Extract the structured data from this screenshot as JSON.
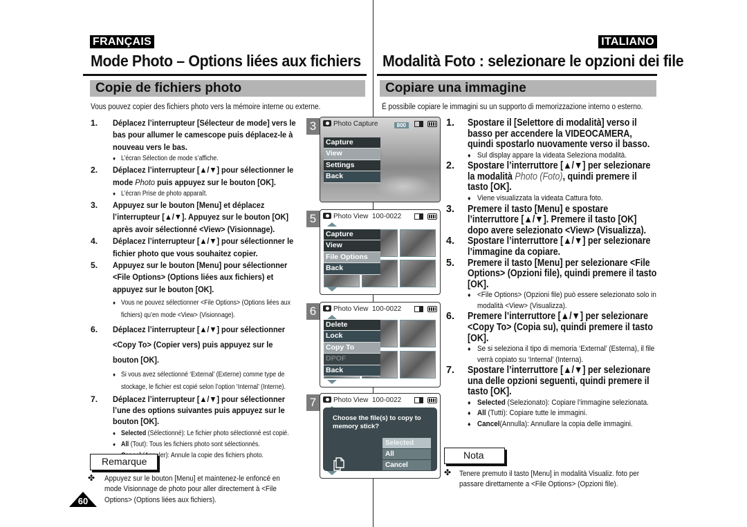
{
  "fr": {
    "lang": "FRANÇAIS",
    "title": "Mode Photo – Options liées aux fichiers",
    "section": "Copie de fichiers photo",
    "intro": "Vous pouvez copier des fichiers photo vers la mémoire interne ou externe.",
    "steps": [
      {
        "num": "1.",
        "text": "Déplacez l’interrupteur [Sélecteur de mode] vers le bas pour allumer le camescope puis déplacez-le à nouveau vers le bas.",
        "subs": [
          "L’écran Sélection de mode s’affiche."
        ]
      },
      {
        "num": "2.",
        "text_a": "Déplacez l’interrupteur [▲/▼] pour sélectionner le mode ",
        "text_em": "Photo",
        "text_b": " puis appuyez sur le bouton [OK].",
        "subs": [
          "L’écran Prise de photo apparaît."
        ]
      },
      {
        "num": "3.",
        "text": "Appuyez sur le bouton [Menu] et déplacez l’interrupteur [▲/▼]. Appuyez sur le bouton [OK] après avoir sélectionné <View> (Visionnage)."
      },
      {
        "num": "4.",
        "text": "Déplacez l’interrupteur [▲/▼] pour sélectionner le fichier photo que vous souhaitez copier."
      },
      {
        "num": "5.",
        "text": "Appuyez sur le bouton [Menu] pour sélectionner <File Options> (Options liées aux fichiers) et appuyez sur le bouton [OK].",
        "subs": [
          "Vous ne pouvez sélectionner <File Options> (Options liées aux fichiers) qu’en mode <View> (Visionnage)."
        ]
      },
      {
        "num": "6.",
        "text": "Déplacez l’interrupteur [▲/▼] pour sélectionner <Copy To> (Copier vers) puis appuyez sur le bouton [OK].",
        "subs": [
          "Si vous avez sélectionné ‘External’ (Externe) comme type de stockage, le fichier est copié selon l’option ‘Internal’ (Interne)."
        ]
      },
      {
        "num": "7.",
        "text": "Déplacez l’interrupteur [▲/▼] pour sélectionner l’une des options suivantes puis appuyez sur le bouton [OK].",
        "options": [
          {
            "term": "Selected",
            "desc": " (Sélectionné): Le fichier photo sélectionné est copié."
          },
          {
            "term": "All",
            "desc": " (Tout):  Tous les fichiers photo sont sélectionnés."
          },
          {
            "term": "Cancel",
            "desc": " (Annuler): Annule la copie des fichiers photo."
          }
        ]
      }
    ],
    "note_label": "Remarque",
    "note_text_1": "Appuyez sur le bouton [Menu] et maintenez-le enfoncé en",
    "note_text_2": "mode Visionnage de photo pour aller directement à <File",
    "note_text_3": "Options> (Options liées aux fichiers).",
    "page_number": "60"
  },
  "it": {
    "lang": "ITALIANO",
    "title": "Modalità Foto : selezionare le opzioni dei file",
    "section": "Copiare una immagine",
    "intro": "È possibile copiare le immagini su un supporto di memorizzazione interno o esterno.",
    "steps": [
      {
        "num": "1.",
        "text": "Spostare il [Selettore di modalità] verso il basso per accendere la VIDEOCAMERA, quindi spostarlo nuovamente verso il basso.",
        "subs": [
          "Sul display appare la videata Seleziona modalità."
        ]
      },
      {
        "num": "2.",
        "text_a": "Spostare l’interruttore [▲/▼] per selezionare la modalità ",
        "text_em": "Photo (Foto)",
        "text_b": ", quindi premere il tasto [OK].",
        "subs": [
          "Viene visualizzata la videata Cattura foto."
        ]
      },
      {
        "num": "3.",
        "text": "Premere il tasto [Menu] e spostare l’interruttore [▲/▼]. Premere il tasto [OK] dopo avere selezionato <View> (Visualizza)."
      },
      {
        "num": "4.",
        "text": "Spostare l’interruttore [▲/▼] per selezionare l’immagine da copiare."
      },
      {
        "num": "5.",
        "text": "Premere il tasto [Menu] per selezionare <File Options> (Opzioni file), quindi premere il tasto [OK].",
        "subs": [
          "<File Options> (Opzioni file) può essere selezionato solo in modalità <View> (Visualizza)."
        ]
      },
      {
        "num": "6.",
        "text": "Premere l’interruttore [▲/▼] per selezionare <Copy To> (Copia su), quindi premere il tasto [OK].",
        "subs": [
          "Se si seleziona il tipo di memoria ‘External’ (Esterna), il file verrà copiato su ‘Internal’ (Interna)."
        ]
      },
      {
        "num": "7.",
        "text": "Spostare l’interruttore [▲/▼] per selezionare una delle opzioni seguenti, quindi premere il tasto [OK].",
        "options": [
          {
            "term": "Selected",
            "desc": " (Selezionato): Copiare l’immagine selezionata."
          },
          {
            "term": "All",
            "desc": " (Tutti): Copiare tutte le immagini."
          },
          {
            "term": "Cancel",
            "desc": "(Annulla): Annullare la copia delle immagini."
          }
        ]
      }
    ],
    "note_label": "Nota",
    "note_text_1": "Tenere premuto il tasto [Menu] in modalità Visualiz. foto per",
    "note_text_2": "passare direttamente a <File Options> (Opzioni file)."
  },
  "screens": [
    {
      "step": "3",
      "header": "Photo Capture",
      "resolution": "800",
      "menu": [
        "Capture",
        "View",
        "Settings",
        "Back"
      ],
      "selected": "View"
    },
    {
      "step": "5",
      "header": "Photo View",
      "file": "100-0022",
      "menu": [
        "Capture",
        "View",
        "File Options",
        "Back"
      ],
      "selected": "File Options"
    },
    {
      "step": "6",
      "header": "Photo View",
      "file": "100-0022",
      "menu": [
        "Delete",
        "Lock",
        "Copy To",
        "DPOF",
        "Back"
      ],
      "selected": "Copy To",
      "disabled": "DPOF"
    },
    {
      "step": "7",
      "header": "Photo View",
      "file": "100-0022",
      "dialog_question": "Choose the file(s) to copy to memory stick?",
      "options": [
        "Selected",
        "All",
        "Cancel"
      ],
      "selected": "Selected"
    }
  ],
  "bullet_glyph": "♦",
  "note_glyph": "✤"
}
